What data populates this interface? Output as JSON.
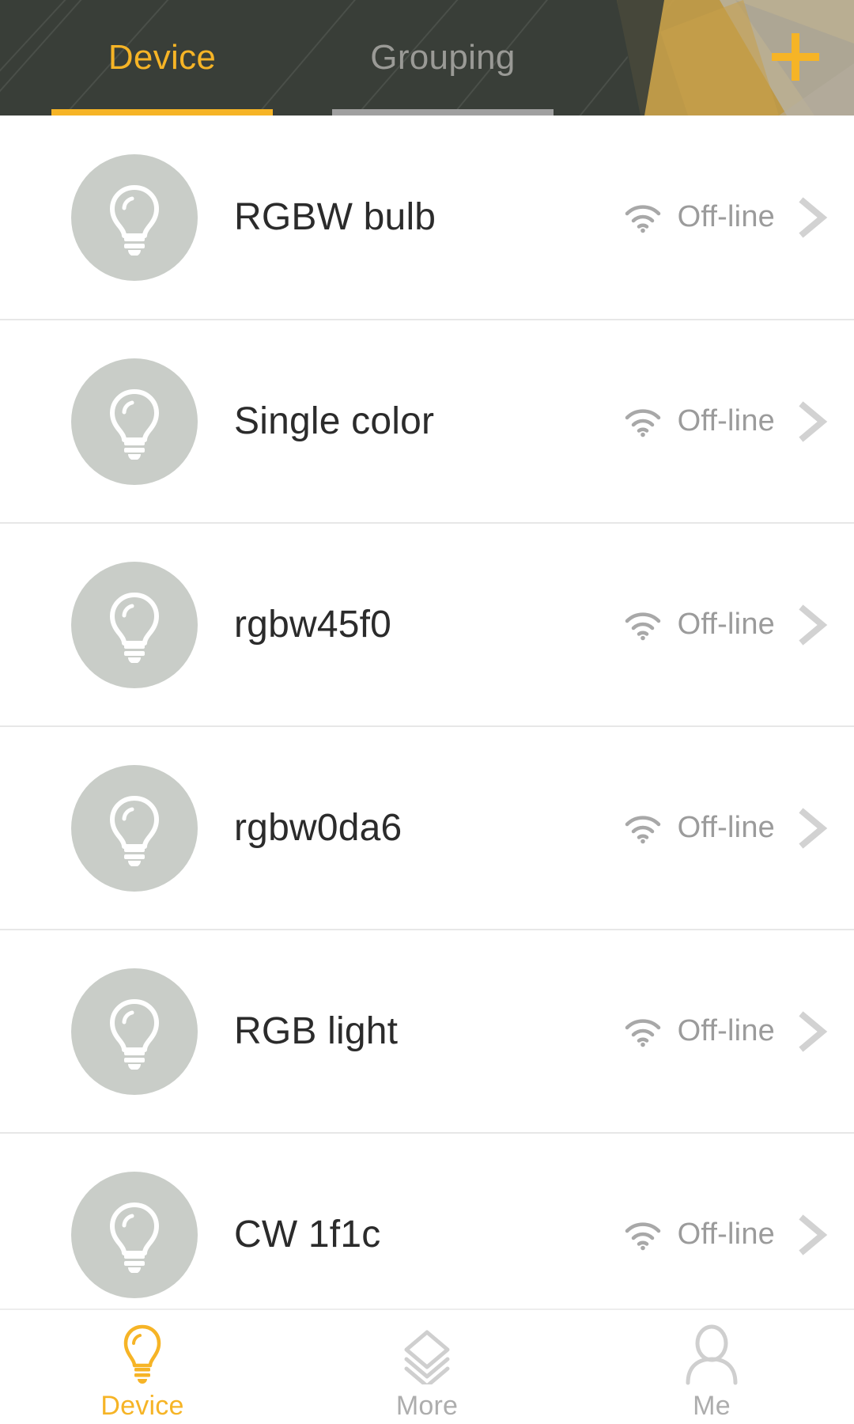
{
  "header": {
    "tabs": [
      {
        "label": "Device",
        "active": true
      },
      {
        "label": "Grouping",
        "active": false
      }
    ],
    "add_button": {
      "name": "add-device-button",
      "glyph": "+"
    },
    "colors": {
      "background": "#393e38",
      "accent": "#f6b426",
      "inactive": "#9a9a96",
      "polygon_gold": "#c9a14a"
    }
  },
  "devices": [
    {
      "name": "RGBW bulb",
      "icon": "bulb-icon",
      "status": "Off-line",
      "status_icon": "wifi-icon",
      "chevron": "chevron-right-icon"
    },
    {
      "name": "Single color",
      "icon": "bulb-icon",
      "status": "Off-line",
      "status_icon": "wifi-icon",
      "chevron": "chevron-right-icon"
    },
    {
      "name": "rgbw45f0",
      "icon": "bulb-icon",
      "status": "Off-line",
      "status_icon": "wifi-icon",
      "chevron": "chevron-right-icon"
    },
    {
      "name": "rgbw0da6",
      "icon": "bulb-icon",
      "status": "Off-line",
      "status_icon": "wifi-icon",
      "chevron": "chevron-right-icon"
    },
    {
      "name": "RGB light",
      "icon": "bulb-icon",
      "status": "Off-line",
      "status_icon": "wifi-icon",
      "chevron": "chevron-right-icon"
    },
    {
      "name": "CW 1f1c",
      "icon": "bulb-icon",
      "status": "Off-line",
      "status_icon": "wifi-icon",
      "chevron": "chevron-right-icon"
    }
  ],
  "bottom_nav": {
    "items": [
      {
        "label": "Device",
        "icon": "bulb-icon",
        "active": true
      },
      {
        "label": "More",
        "icon": "layers-icon",
        "active": false
      },
      {
        "label": "Me",
        "icon": "person-icon",
        "active": false
      }
    ],
    "colors": {
      "active": "#f6b426",
      "inactive": "#adadad"
    }
  },
  "list_style": {
    "row_bg": "#ffffff",
    "divider": "#e7e7e7",
    "avatar_bg": "#c9cdc8",
    "name_color": "#2b2b2b",
    "status_color": "#9b9b9b"
  }
}
